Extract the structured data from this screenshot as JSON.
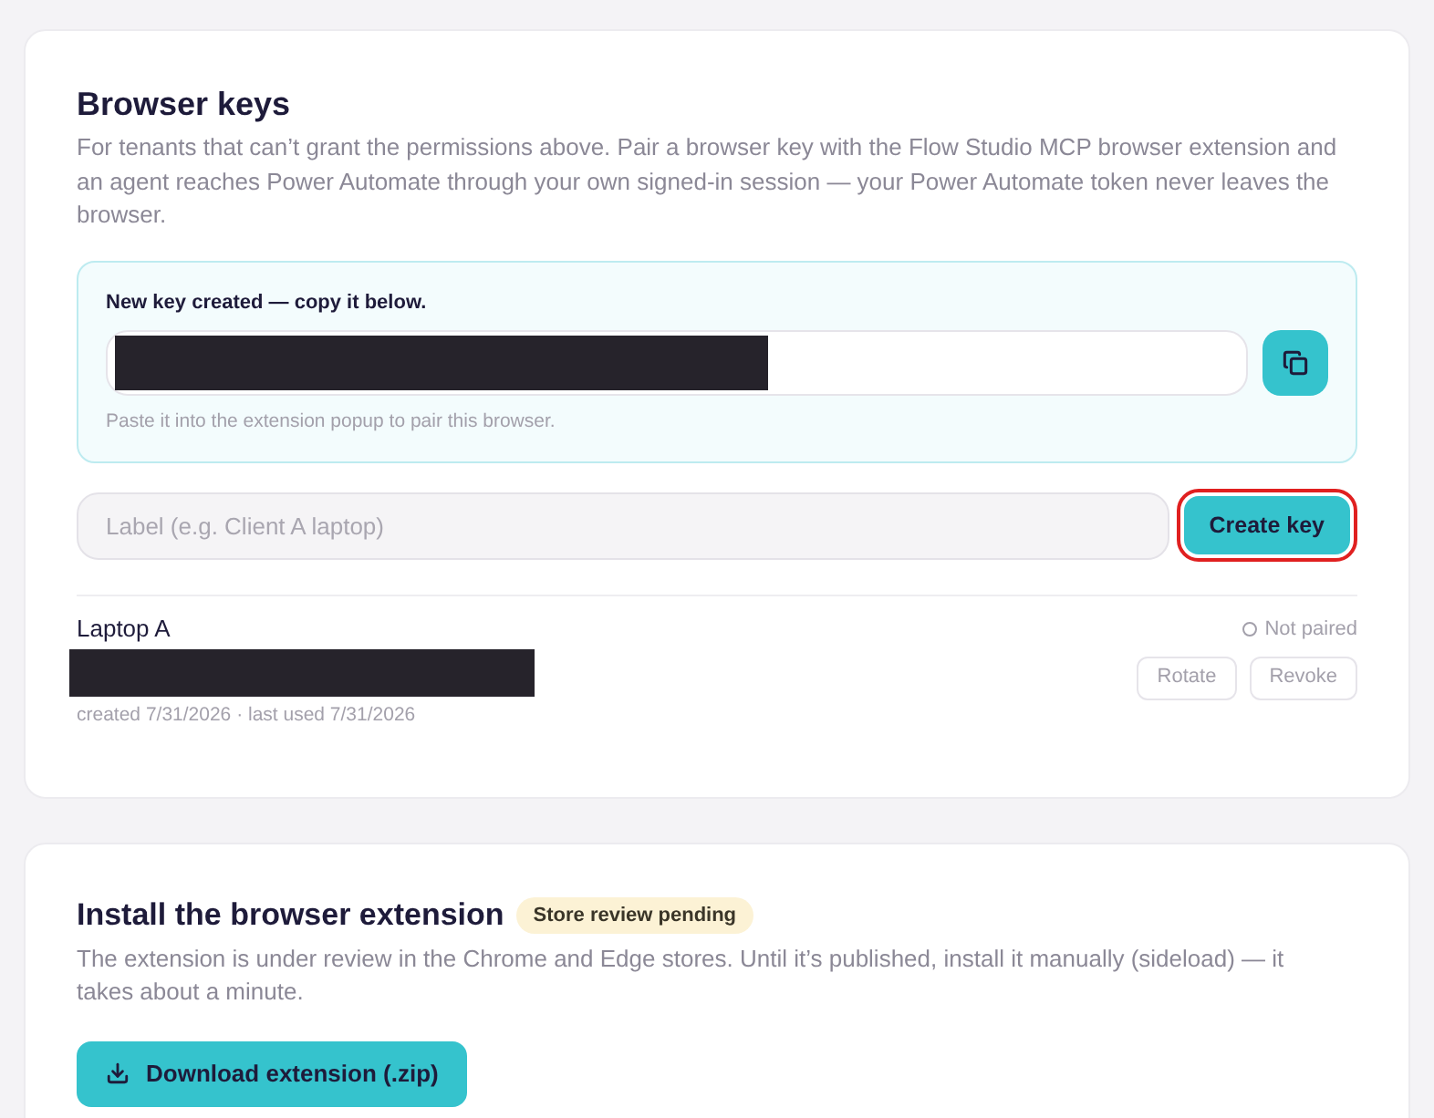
{
  "browser_keys": {
    "title": "Browser keys",
    "description": "For tenants that can’t grant the permissions above. Pair a browser key with the Flow Studio MCP browser extension and an agent reaches Power Automate through your own signed-in session — your Power Automate token never leaves the browser.",
    "new_key": {
      "heading": "New key created — copy it below.",
      "key_redacted": true,
      "hint": "Paste it into the extension popup to pair this browser."
    },
    "label_field": {
      "placeholder": "Label (e.g. Client A laptop)"
    },
    "create_button": {
      "label": "Create key",
      "highlighted": true
    },
    "keys": [
      {
        "name": "Laptop A",
        "key_redacted": true,
        "meta": "created 7/31/2026 · last used 7/31/2026",
        "status": "Not paired",
        "paired": false,
        "actions": [
          "Rotate",
          "Revoke"
        ]
      }
    ]
  },
  "install_extension": {
    "title": "Install the browser extension",
    "badge": "Store review pending",
    "description": "The extension is under review in the Chrome and Edge stores. Until it’s published, install it manually (sideload) — it takes about a minute.",
    "download_button": "Download extension (.zip)"
  }
}
